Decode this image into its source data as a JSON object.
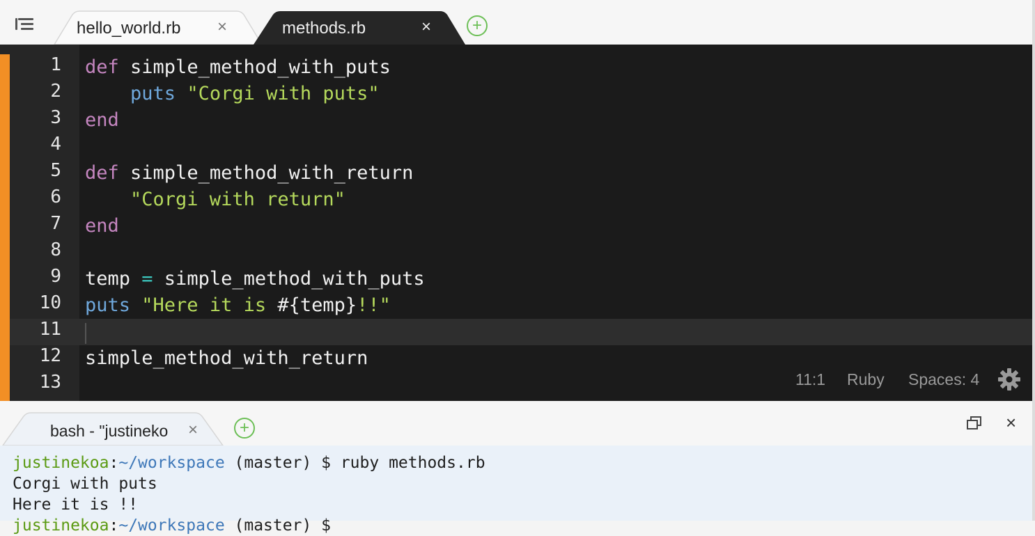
{
  "tabs": [
    {
      "label": "hello_world.rb",
      "close": "×",
      "active": false
    },
    {
      "label": "methods.rb",
      "close": "×",
      "active": true
    }
  ],
  "new_tab_symbol": "+",
  "editor": {
    "line_numbers": [
      "1",
      "2",
      "3",
      "4",
      "5",
      "6",
      "7",
      "8",
      "9",
      "10",
      "11",
      "12",
      "13"
    ],
    "code": {
      "l1_kw": "def",
      "l1_rest": " simple_method_with_puts",
      "l2_indent": "    ",
      "l2_fn": "puts",
      "l2_str": " \"Corgi with puts\"",
      "l3_kw": "end",
      "l5_kw": "def",
      "l5_rest": " simple_method_with_return",
      "l6_str": "    \"Corgi with return\"",
      "l7_kw": "end",
      "l9_a": "temp ",
      "l9_op": "=",
      "l9_b": " simple_method_with_puts",
      "l10_fn": "puts",
      "l10_s1": " \"Here it is ",
      "l10_interp": "#{temp}",
      "l10_s2": "!!\"",
      "l12": "simple_method_with_return"
    },
    "accent_color": "#f28f25"
  },
  "status": {
    "position": "11:1",
    "language": "Ruby",
    "indent": "Spaces: 4"
  },
  "terminal": {
    "tab_label": "bash - \"justineko",
    "tab_close": "×",
    "close": "×",
    "prompt_user": "justinekoa",
    "prompt_sep": ":",
    "prompt_path": "~/workspace",
    "prompt_rest": " (master) $ ruby methods.rb",
    "output1": "Corgi with puts",
    "output2": "Here it is !!",
    "last_user": "justinekoa",
    "last_sep": ":",
    "last_path": "~/workspace",
    "last_rest": " (master) $ "
  }
}
